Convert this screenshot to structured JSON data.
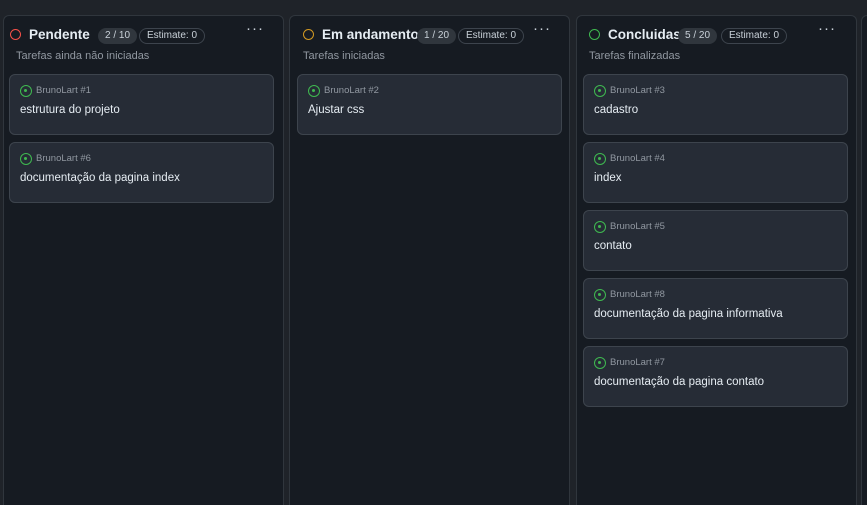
{
  "columns": [
    {
      "title": "Pendente",
      "count": "2 / 10",
      "estimate": "Estimate: 0",
      "more": "···",
      "description": "Tarefas ainda não iniciadas",
      "status_color": "#f85149",
      "cards": [
        {
          "ref": "BrunoLart #1",
          "title": "estrutura do projeto"
        },
        {
          "ref": "BrunoLart #6",
          "title": "documentação da pagina index"
        }
      ]
    },
    {
      "title": "Em andamento",
      "count": "1 / 20",
      "estimate": "Estimate: 0",
      "more": "···",
      "description": "Tarefas iniciadas",
      "status_color": "#d29922",
      "cards": [
        {
          "ref": "BrunoLart #2",
          "title": "Ajustar css"
        }
      ]
    },
    {
      "title": "Concluidas",
      "count": "5 / 20",
      "estimate": "Estimate: 0",
      "more": "···",
      "description": "Tarefas finalizadas",
      "status_color": "#3fb950",
      "cards": [
        {
          "ref": "BrunoLart #3",
          "title": "cadastro"
        },
        {
          "ref": "BrunoLart #4",
          "title": "index"
        },
        {
          "ref": "BrunoLart #5",
          "title": "contato"
        },
        {
          "ref": "BrunoLart #8",
          "title": "documentação da pagina informativa"
        },
        {
          "ref": "BrunoLart #7",
          "title": "documentação da pagina contato"
        }
      ]
    }
  ],
  "colors": {
    "page_bg": "#1f2329",
    "column_bg": "#161b22",
    "card_bg": "#262c36",
    "issue_open": "#3fb950"
  },
  "icons": {
    "card_issue": "issue-opened-icon",
    "column_menu": "kebab-horizontal-icon"
  }
}
